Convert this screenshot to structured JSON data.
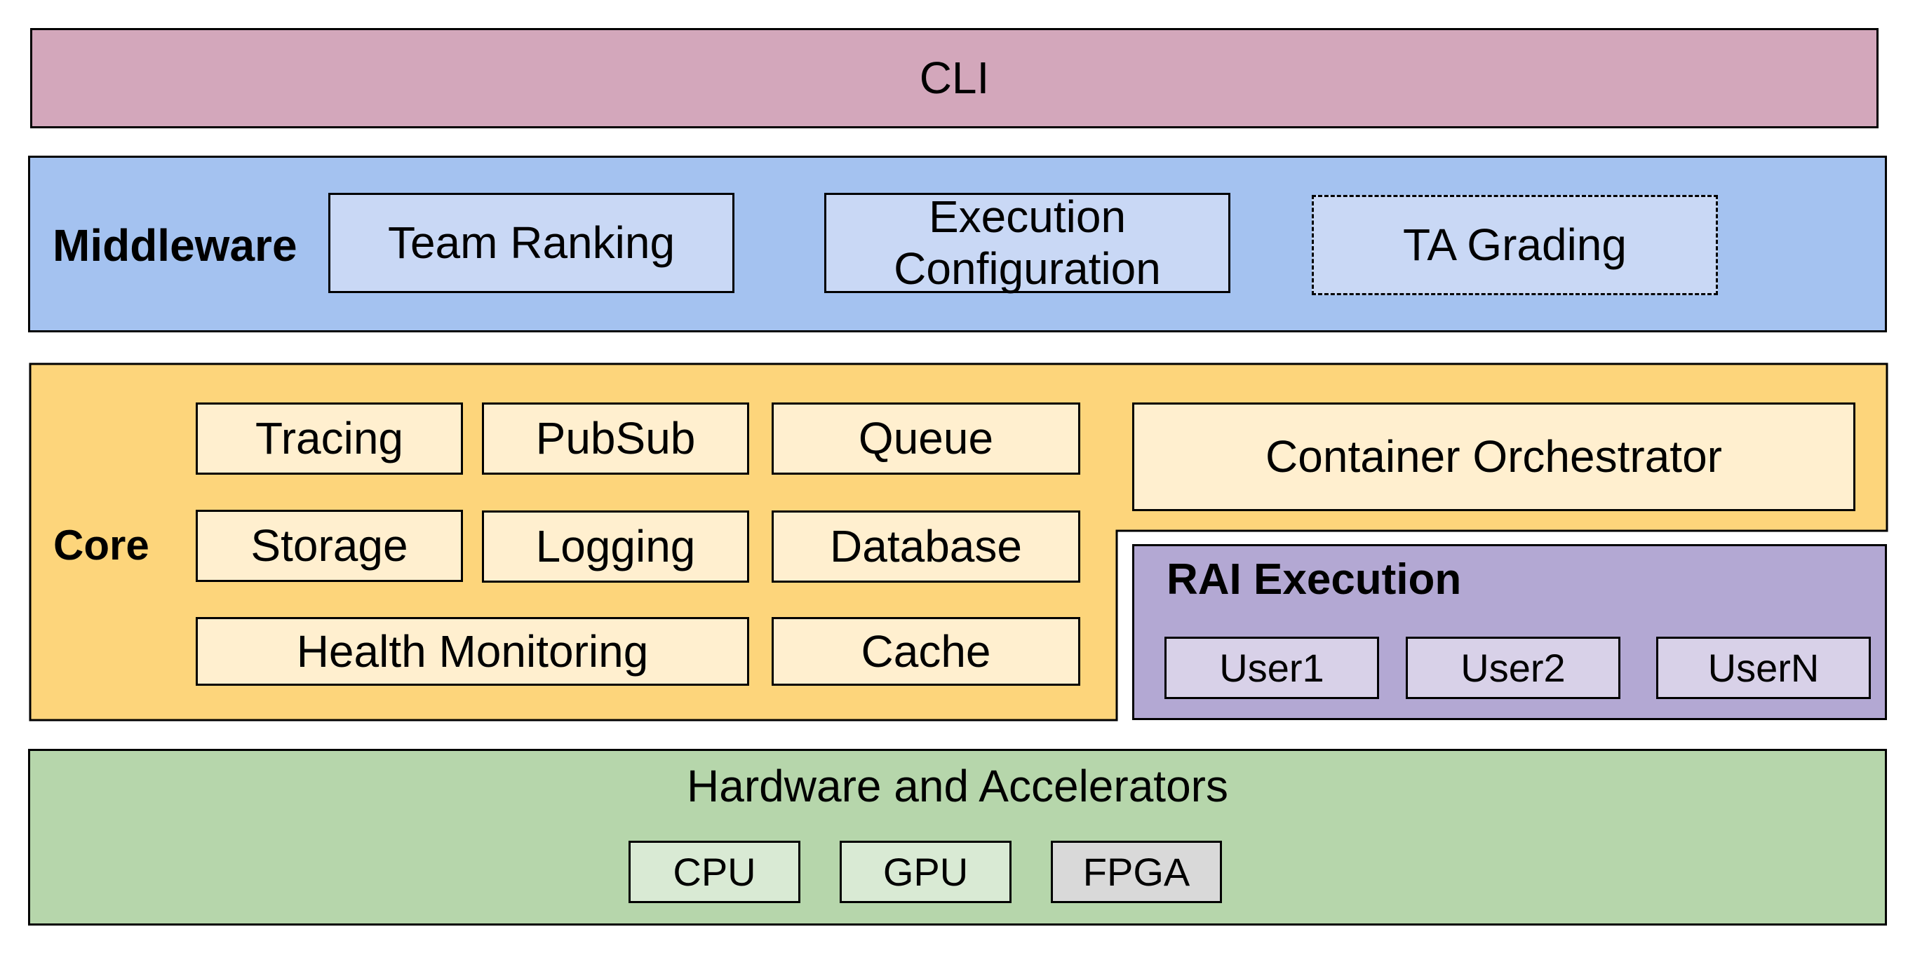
{
  "colors": {
    "cli": "#d3a7bb",
    "middleware": "#a4c2f0",
    "middleware_item": "#c9d8f5",
    "core": "#fdd57b",
    "core_item": "#ffefcf",
    "rai": "#b3a8d3",
    "rai_item": "#d8d1e8",
    "hardware": "#b6d6ab",
    "hardware_item": "#d9ead4",
    "hardware_item_muted": "#d9d9d9"
  },
  "cli": {
    "label": "CLI"
  },
  "middleware": {
    "label": "Middleware",
    "items": [
      {
        "label": "Team Ranking",
        "style": "solid"
      },
      {
        "label": "Execution Configuration",
        "style": "solid"
      },
      {
        "label": "TA Grading",
        "style": "dashed"
      }
    ]
  },
  "core": {
    "label": "Core",
    "items": [
      "Tracing",
      "PubSub",
      "Queue",
      "Storage",
      "Logging",
      "Database",
      "Health Monitoring",
      "Cache"
    ],
    "orchestrator": "Container Orchestrator"
  },
  "rai": {
    "label": "RAI Execution",
    "users": [
      "User1",
      "User2",
      "UserN"
    ]
  },
  "hardware": {
    "label": "Hardware and Accelerators",
    "items": [
      "CPU",
      "GPU",
      "FPGA"
    ]
  }
}
